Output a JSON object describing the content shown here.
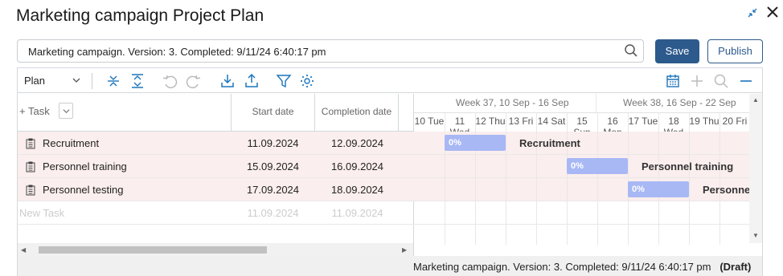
{
  "window": {
    "title": "Marketing campaign Project Plan"
  },
  "header": {
    "search_value": "Marketing campaign. Version: 3. Completed: 9/11/24 6:40:17 pm",
    "save_label": "Save",
    "publish_label": "Publish"
  },
  "toolbar": {
    "view_select": "Plan"
  },
  "grid": {
    "add_task_label": "+ Task",
    "col_start": "Start date",
    "col_end": "Completion date",
    "rows": [
      {
        "name": "Recruitment",
        "start": "11.09.2024",
        "end": "12.09.2024",
        "progress": "0%"
      },
      {
        "name": "Personnel training",
        "start": "15.09.2024",
        "end": "16.09.2024",
        "progress": "0%"
      },
      {
        "name": "Personnel testing",
        "start": "17.09.2024",
        "end": "18.09.2024",
        "progress": "0%"
      }
    ],
    "new_row": {
      "name": "New Task",
      "start": "11.09.2024",
      "end": "11.09.2024"
    }
  },
  "gantt": {
    "weeks": [
      "Week 37, 10 Sep - 16 Sep",
      "Week 38, 16 Sep - 22 Sep"
    ],
    "days": [
      "10 Tue",
      "11 Wed",
      "12 Thu",
      "13 Fri",
      "14 Sat",
      "15 Sun",
      "16 Mon",
      "17 Tue",
      "18 Wed",
      "19 Thu",
      "20 Fri"
    ],
    "bar_labels": [
      "Recruitment",
      "Personnel training",
      "Personnel t"
    ]
  },
  "status": {
    "text": "Marketing campaign. Version: 3. Completed: 9/11/24 6:40:17 pm",
    "state": "(Draft)"
  },
  "colors": {
    "accent": "#2d5a8c",
    "bar": "#a8b8f5",
    "task_row": "#fbeeee"
  }
}
